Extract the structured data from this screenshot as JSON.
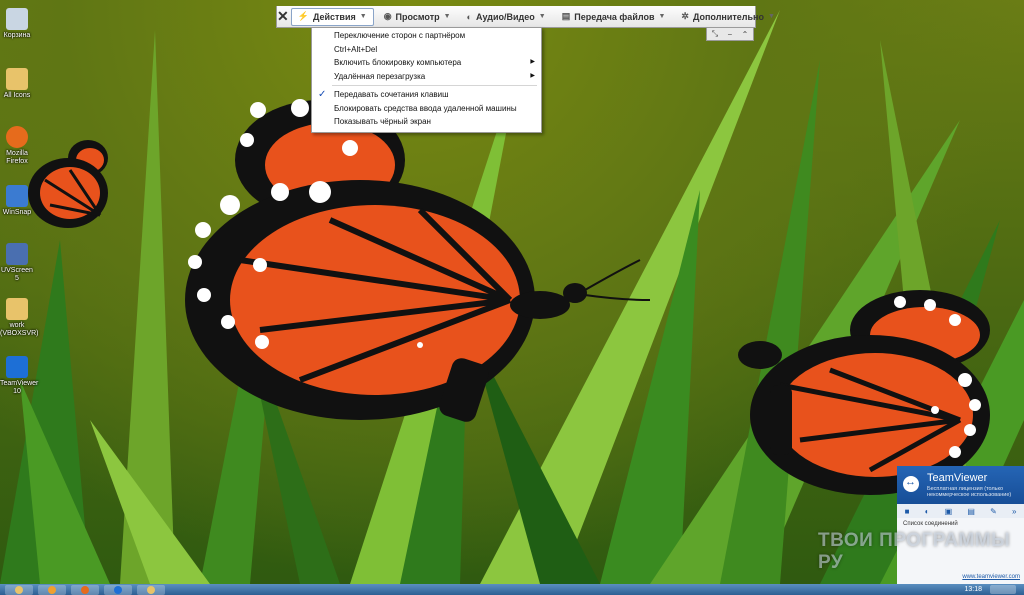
{
  "desktop_icons": [
    {
      "label": "Корзина",
      "icon": "recycle-bin-icon",
      "color": "#c9d6e3"
    },
    {
      "label": "All Icons",
      "icon": "folder-icon",
      "color": "#e8c36a"
    },
    {
      "label": "Mozilla Firefox",
      "icon": "firefox-icon",
      "color": "#e66b1c"
    },
    {
      "label": "WinSnap",
      "icon": "winsnap-icon",
      "color": "#3b7bd1"
    },
    {
      "label": "UVScreen 5",
      "icon": "uvscreen-icon",
      "color": "#4a6fb0"
    },
    {
      "label": "work (VBOXSVR)",
      "icon": "network-drive-icon",
      "color": "#e8c36a"
    },
    {
      "label": "TeamViewer 10",
      "icon": "teamviewer-icon",
      "color": "#1d6fd6"
    }
  ],
  "toolbar": {
    "close_label": "✕",
    "buttons": [
      {
        "label": "Действия",
        "icon": "lightning-icon",
        "active": true
      },
      {
        "label": "Просмотр",
        "icon": "eye-icon",
        "active": false
      },
      {
        "label": "Аудио/Видео",
        "icon": "headset-icon",
        "active": false
      },
      {
        "label": "Передача файлов",
        "icon": "file-transfer-icon",
        "active": false
      },
      {
        "label": "Дополнительно",
        "icon": "gears-icon",
        "active": false
      }
    ],
    "mini": [
      "⤡",
      "−",
      "⌃"
    ]
  },
  "menu": {
    "group1": [
      {
        "label": "Переключение сторон с партнёром",
        "submenu": false
      },
      {
        "label": "Ctrl+Alt+Del",
        "submenu": false
      },
      {
        "label": "Включить блокировку компьютера",
        "submenu": true
      },
      {
        "label": "Удалённая перезагрузка",
        "submenu": true
      }
    ],
    "group2": [
      {
        "label": "Передавать сочетания клавиш",
        "checked": true
      },
      {
        "label": "Блокировать средства ввода удаленной машины",
        "checked": false
      },
      {
        "label": "Показывать чёрный экран",
        "checked": false
      }
    ]
  },
  "teamviewer_panel": {
    "name": "TeamViewer",
    "subtitle": "Бесплатная лицензия (только некоммерческое использование)",
    "list_title": "Список соединений",
    "link": "www.teamviewer.com"
  },
  "watermark": "ТВОИ ПРОГРАММЫ РУ",
  "taskbar": {
    "clock": "13:18",
    "items": [
      "explorer-icon",
      "media-icon",
      "firefox-icon",
      "teamviewer-icon",
      "folder-icon"
    ]
  },
  "colors": {
    "wing_orange": "#e8521c",
    "wing_black": "#111111",
    "grass_light": "#8cc63f",
    "grass_dark": "#2f7a1c",
    "background": "#5f7614"
  }
}
